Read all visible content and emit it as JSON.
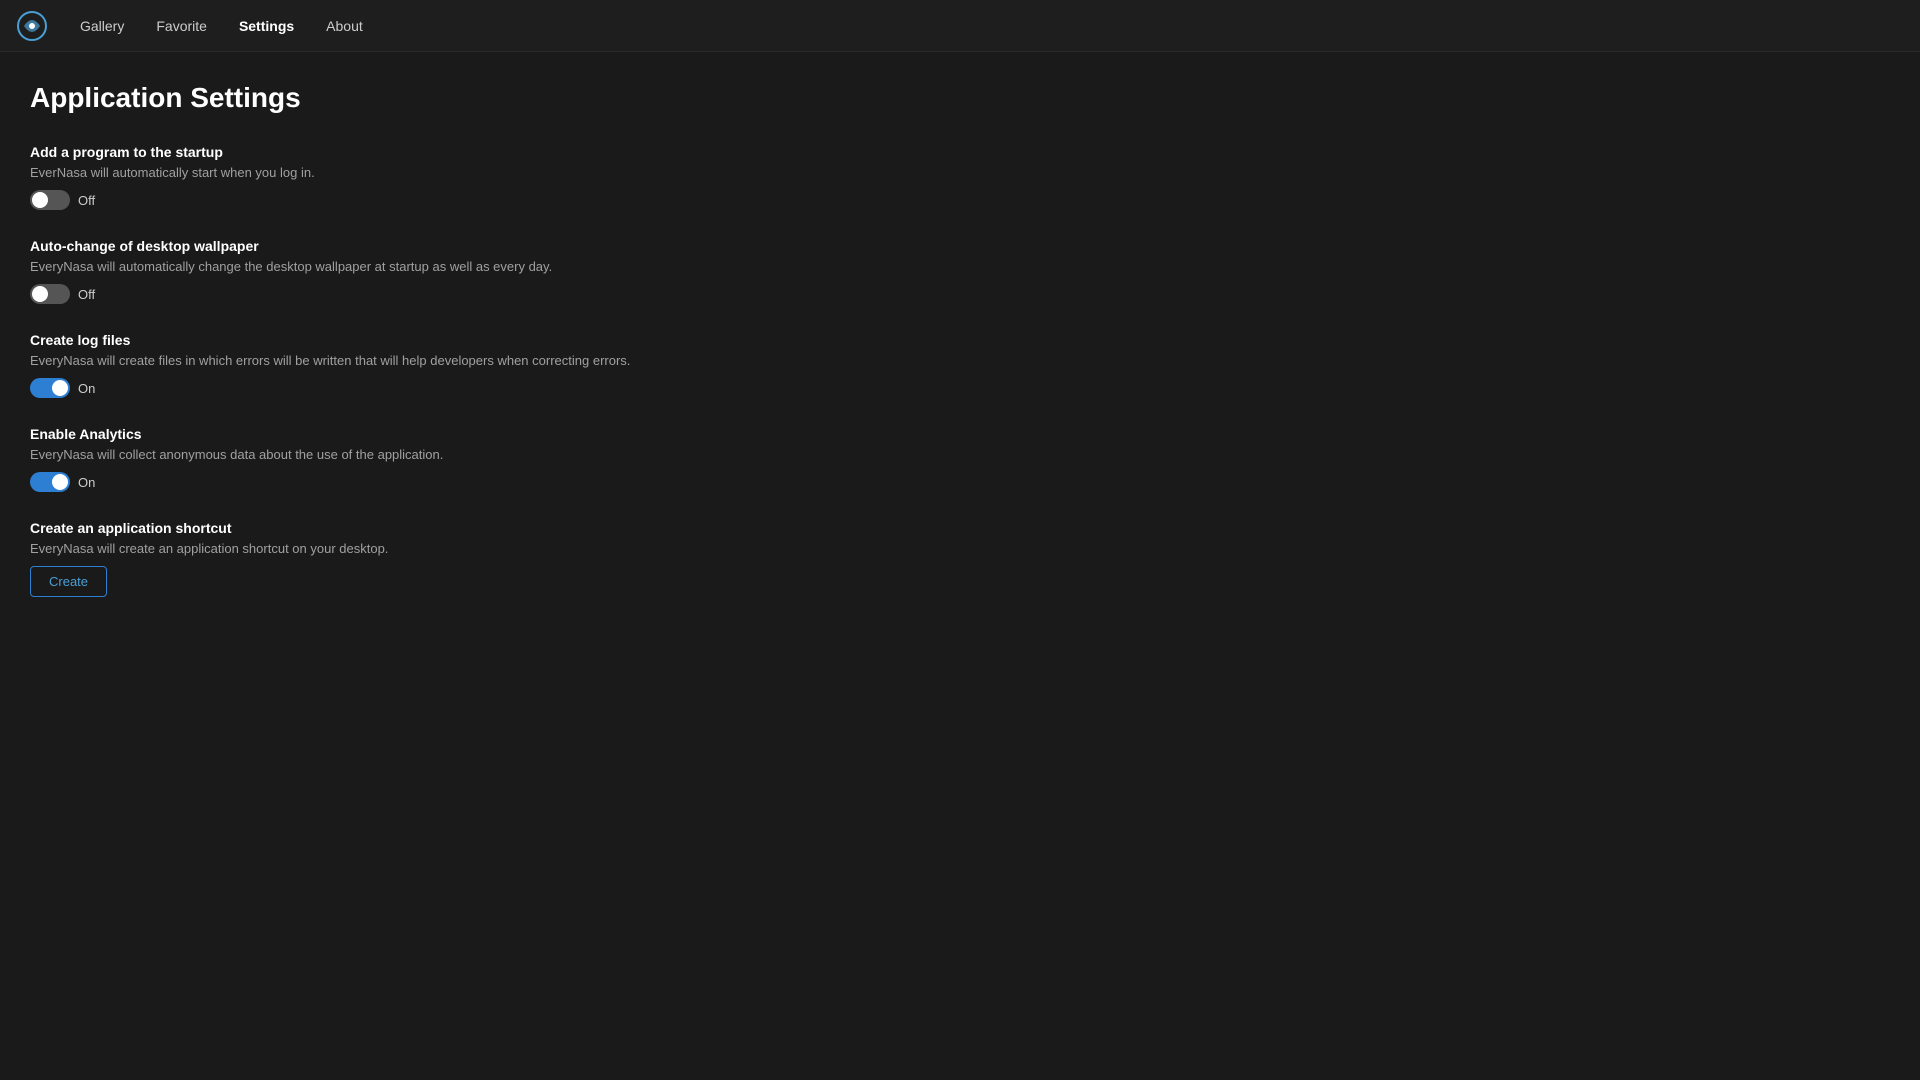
{
  "app": {
    "logo_alt": "EverNasa Logo"
  },
  "nav": {
    "items": [
      {
        "id": "gallery",
        "label": "Gallery",
        "active": false
      },
      {
        "id": "favorite",
        "label": "Favorite",
        "active": false
      },
      {
        "id": "settings",
        "label": "Settings",
        "active": true
      },
      {
        "id": "about",
        "label": "About",
        "active": false
      }
    ]
  },
  "page": {
    "title": "Application Settings"
  },
  "settings": [
    {
      "id": "startup",
      "title": "Add a program to the startup",
      "description": "EverNasa will automatically start when you log in.",
      "toggle_state": "off",
      "toggle_label": "Off"
    },
    {
      "id": "wallpaper",
      "title": "Auto-change of desktop wallpaper",
      "description": "EveryNasa will automatically change the desktop wallpaper at startup as well as every day.",
      "toggle_state": "off",
      "toggle_label": "Off"
    },
    {
      "id": "log_files",
      "title": "Create log files",
      "description": "EveryNasa will create files in which errors will be written that will help developers when correcting errors.",
      "toggle_state": "on",
      "toggle_label": "On"
    },
    {
      "id": "analytics",
      "title": "Enable Analytics",
      "description": "EveryNasa will collect anonymous data about the use of the application.",
      "toggle_state": "on",
      "toggle_label": "On"
    },
    {
      "id": "shortcut",
      "title": "Create an application shortcut",
      "description": "EveryNasa will create an application shortcut on your desktop.",
      "button_label": "Create"
    }
  ]
}
